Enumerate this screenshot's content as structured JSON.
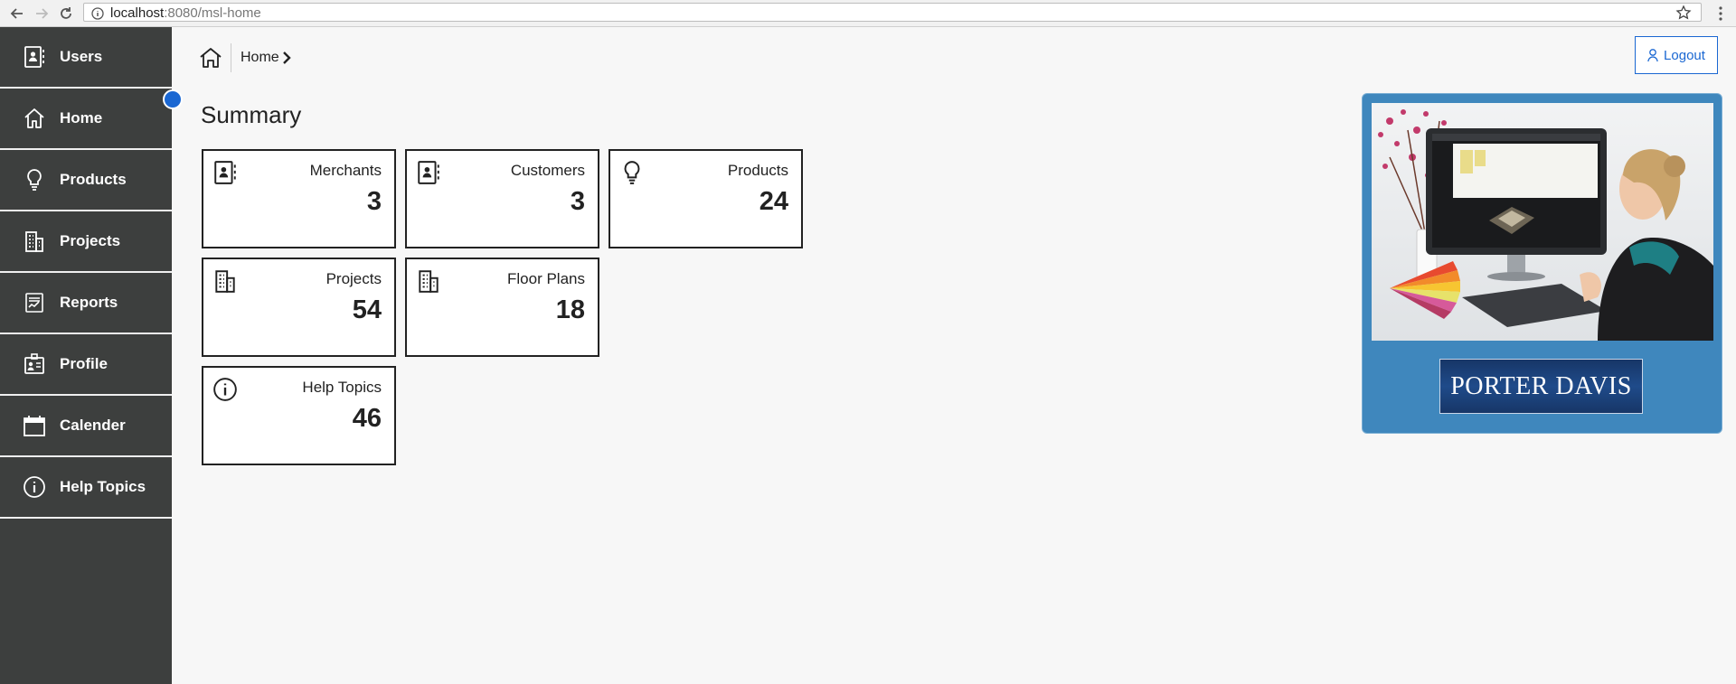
{
  "browser": {
    "url_host": "localhost",
    "url_path": ":8080/msl-home"
  },
  "sidebar": {
    "items": [
      {
        "label": "Users",
        "icon": "contact-book-icon"
      },
      {
        "label": "Home",
        "icon": "home-icon"
      },
      {
        "label": "Products",
        "icon": "lightbulb-icon"
      },
      {
        "label": "Projects",
        "icon": "building-icon"
      },
      {
        "label": "Reports",
        "icon": "report-chart-icon"
      },
      {
        "label": "Profile",
        "icon": "id-card-icon"
      },
      {
        "label": "Calender",
        "icon": "calendar-icon"
      },
      {
        "label": "Help Topics",
        "icon": "info-icon"
      }
    ],
    "active_index": 1,
    "accent": "#1a67d2",
    "background": "#3d3f3e"
  },
  "breadcrumb": {
    "current": "Home"
  },
  "header": {
    "logout_label": "Logout"
  },
  "main": {
    "title": "Summary",
    "tiles": [
      {
        "label": "Merchants",
        "count": "3",
        "icon": "contact-book-icon"
      },
      {
        "label": "Customers",
        "count": "3",
        "icon": "contact-book-icon"
      },
      {
        "label": "Products",
        "count": "24",
        "icon": "lightbulb-icon"
      },
      {
        "label": "Projects",
        "count": "54",
        "icon": "building-icon"
      },
      {
        "label": "Floor Plans",
        "count": "18",
        "icon": "building-icon"
      },
      {
        "label": "Help Topics",
        "count": "46",
        "icon": "info-icon"
      }
    ]
  },
  "promo": {
    "brand": "PORTER DAVIS",
    "panel_color": "#3f87bd"
  }
}
